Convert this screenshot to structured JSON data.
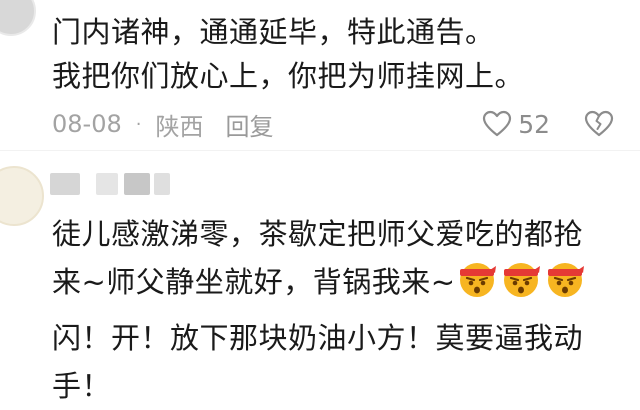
{
  "comment1": {
    "line1": "门内诸神，通通延毕，特此通告。",
    "line2": "我把你们放心上，你把为师挂网上。",
    "date": "08-08",
    "separator": "·",
    "location": "陕西",
    "reply_label": "回复",
    "like_count": "52"
  },
  "comment2": {
    "line1": "徒儿感激涕零，茶歇定把师父爱吃的都抢",
    "line2": "来~师父静坐就好，背锅我来~",
    "line3": "闪！开！放下那块奶油小方！莫要逼我动",
    "line4": "手！",
    "emojis": [
      "angry-headband-emoji",
      "angry-headband-emoji",
      "angry-headband-emoji"
    ]
  },
  "colors": {
    "text": "#1a1a1a",
    "meta": "#a3a3a3",
    "emoji_face": "#f7b521",
    "emoji_band": "#e53935"
  }
}
